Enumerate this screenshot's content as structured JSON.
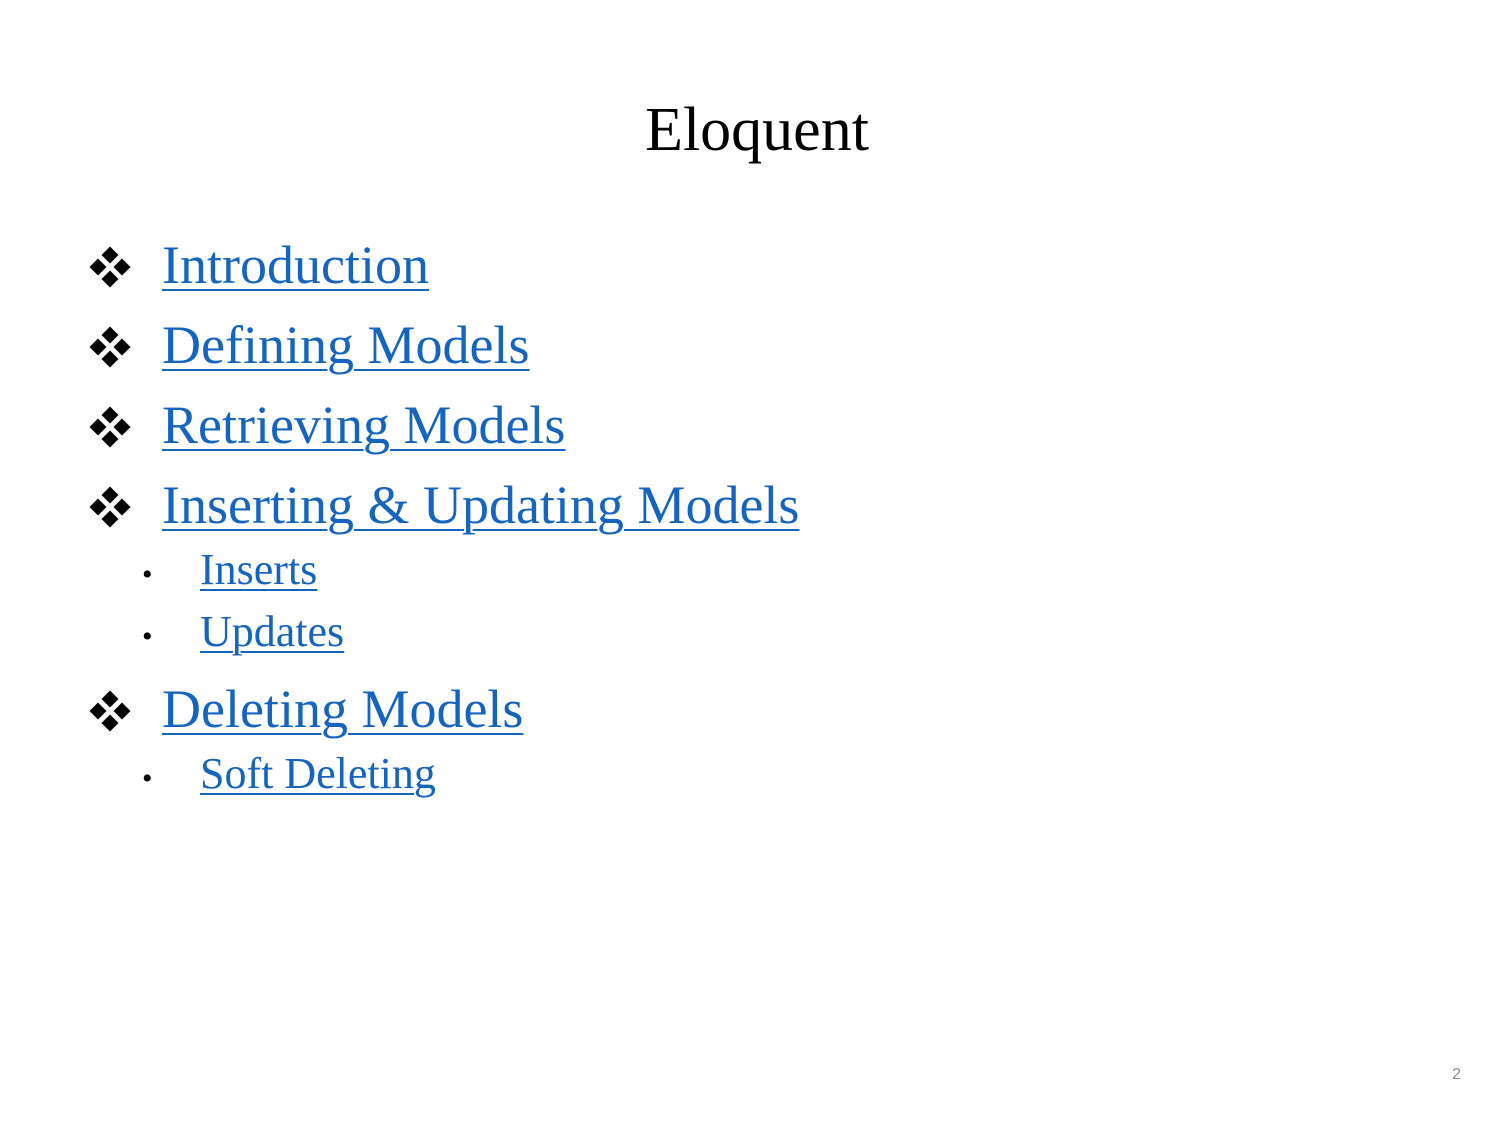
{
  "slide": {
    "title": "Eloquent",
    "page_number": "2",
    "link_color": "#1565c0",
    "items": [
      {
        "label": "Introduction",
        "bullet": "diamond-cluster",
        "children": []
      },
      {
        "label": "Defining Models",
        "bullet": "diamond-cluster",
        "children": []
      },
      {
        "label": "Retrieving Models",
        "bullet": "diamond-cluster",
        "children": []
      },
      {
        "label": "Inserting & Updating Models",
        "bullet": "diamond-cluster",
        "children": [
          {
            "label": "Inserts",
            "bullet": "•"
          },
          {
            "label": "Updates",
            "bullet": "•"
          }
        ]
      },
      {
        "label": "Deleting Models",
        "bullet": "diamond-cluster",
        "children": [
          {
            "label": "Soft Deleting",
            "bullet": "•"
          }
        ]
      }
    ]
  }
}
